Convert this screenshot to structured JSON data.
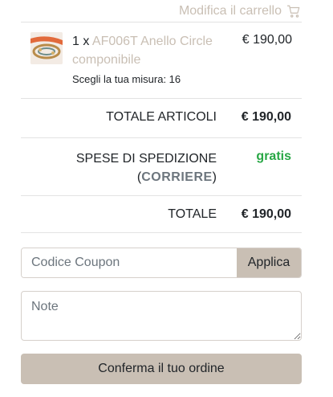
{
  "header": {
    "edit_cart_label": "Modifica il carrello",
    "cart_icon": "shopping-cart-icon"
  },
  "item": {
    "quantity": "1 x",
    "name": "AF006T Anello Circle componibile",
    "size_text": "Scegli la tua misura: 16",
    "price": "€ 190,00",
    "thumbnail_icon": "ring-product-thumbnail"
  },
  "summary": {
    "articles_label": "TOTALE ARTICOLI",
    "articles_value": "€ 190,00",
    "shipping_label": "SPESE DI SPEDIZIONE",
    "shipping_method_open": "(",
    "shipping_method": "CORRIERE",
    "shipping_method_close": ")",
    "shipping_value": "gratis",
    "total_label": "TOTALE",
    "total_value": "€ 190,00"
  },
  "coupon": {
    "placeholder": "Codice Coupon",
    "button_label": "Applica"
  },
  "notes": {
    "placeholder": "Note"
  },
  "confirm_label": "Conferma il tuo ordine",
  "colors": {
    "accent": "#c9bfb4",
    "free_shipping": "#28a745",
    "method_text": "#6c757d"
  }
}
